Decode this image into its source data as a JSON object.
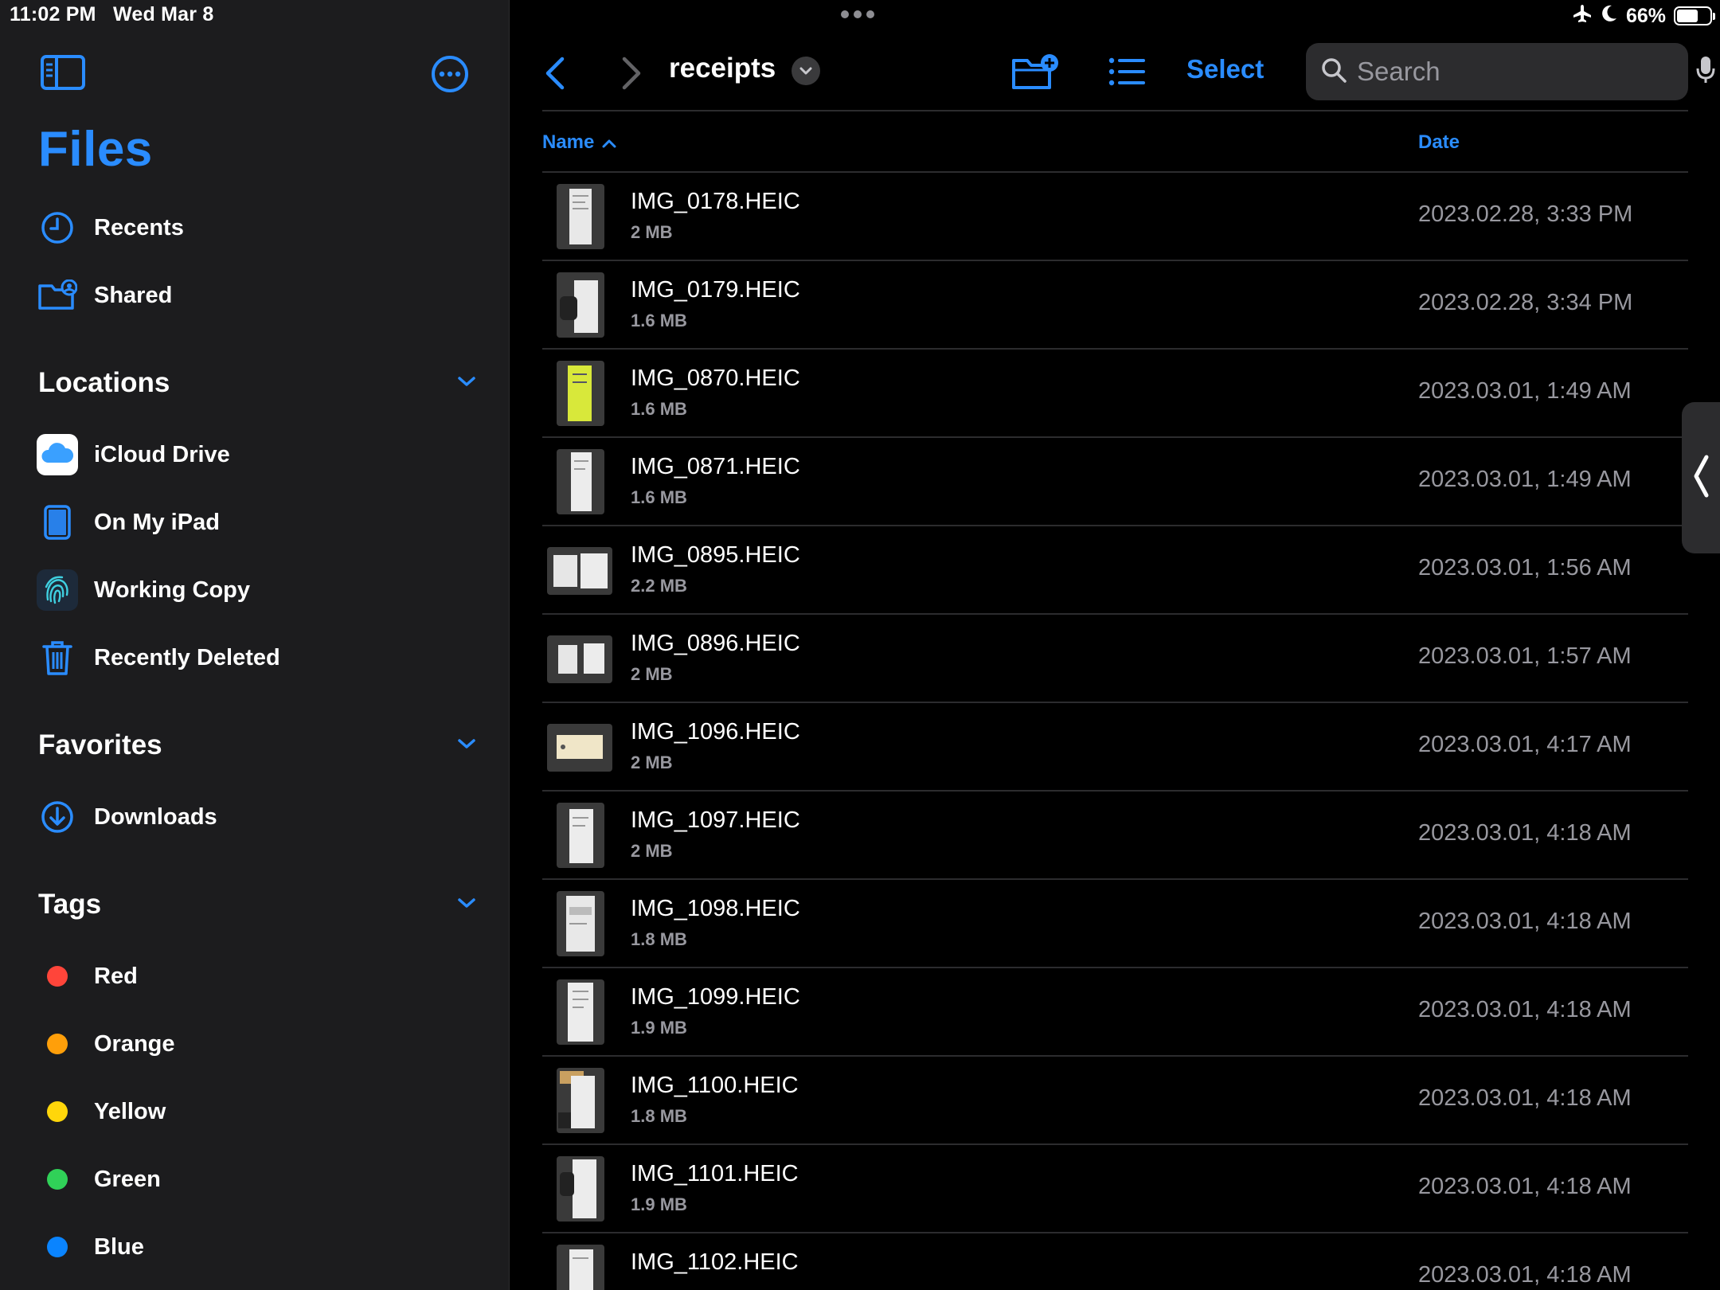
{
  "status_bar": {
    "time": "11:02 PM",
    "date": "Wed Mar 8",
    "battery": "66%",
    "battery_level": 0.66,
    "icons": [
      "airplane-icon",
      "moon-icon",
      "battery-icon"
    ]
  },
  "sidebar": {
    "title": "Files",
    "items": [
      {
        "label": "Recents",
        "icon": "clock-icon"
      },
      {
        "label": "Shared",
        "icon": "shared-folder-icon"
      }
    ],
    "locations": {
      "title": "Locations",
      "items": [
        {
          "label": "iCloud Drive",
          "icon": "icloud-icon"
        },
        {
          "label": "On My iPad",
          "icon": "ipad-icon"
        },
        {
          "label": "Working Copy",
          "icon": "fingerprint-icon"
        },
        {
          "label": "Recently Deleted",
          "icon": "trash-icon"
        }
      ]
    },
    "favorites": {
      "title": "Favorites",
      "items": [
        {
          "label": "Downloads",
          "icon": "download-icon"
        }
      ]
    },
    "tags": {
      "title": "Tags",
      "items": [
        {
          "label": "Red",
          "color": "#ff453a"
        },
        {
          "label": "Orange",
          "color": "#ff9f0a"
        },
        {
          "label": "Yellow",
          "color": "#ffd60a"
        },
        {
          "label": "Green",
          "color": "#30d158"
        },
        {
          "label": "Blue",
          "color": "#0a84ff"
        }
      ]
    }
  },
  "toolbar": {
    "folder_title": "receipts",
    "select_label": "Select",
    "search_placeholder": "Search"
  },
  "columns": {
    "name": "Name",
    "date": "Date"
  },
  "files": [
    {
      "name": "IMG_0178.HEIC",
      "size": "2 MB",
      "date": "2023.02.28, 3:33 PM"
    },
    {
      "name": "IMG_0179.HEIC",
      "size": "1.6 MB",
      "date": "2023.02.28, 3:34 PM"
    },
    {
      "name": "IMG_0870.HEIC",
      "size": "1.6 MB",
      "date": "2023.03.01, 1:49 AM"
    },
    {
      "name": "IMG_0871.HEIC",
      "size": "1.6 MB",
      "date": "2023.03.01, 1:49 AM"
    },
    {
      "name": "IMG_0895.HEIC",
      "size": "2.2 MB",
      "date": "2023.03.01, 1:56 AM"
    },
    {
      "name": "IMG_0896.HEIC",
      "size": "2 MB",
      "date": "2023.03.01, 1:57 AM"
    },
    {
      "name": "IMG_1096.HEIC",
      "size": "2 MB",
      "date": "2023.03.01, 4:17 AM"
    },
    {
      "name": "IMG_1097.HEIC",
      "size": "2 MB",
      "date": "2023.03.01, 4:18 AM"
    },
    {
      "name": "IMG_1098.HEIC",
      "size": "1.8 MB",
      "date": "2023.03.01, 4:18 AM"
    },
    {
      "name": "IMG_1099.HEIC",
      "size": "1.9 MB",
      "date": "2023.03.01, 4:18 AM"
    },
    {
      "name": "IMG_1100.HEIC",
      "size": "1.8 MB",
      "date": "2023.03.01, 4:18 AM"
    },
    {
      "name": "IMG_1101.HEIC",
      "size": "1.9 MB",
      "date": "2023.03.01, 4:18 AM"
    },
    {
      "name": "IMG_1102.HEIC",
      "size": "",
      "date": "2023.03.01, 4:18 AM"
    }
  ],
  "colors": {
    "accent": "#2a8cff",
    "sidebar_bg": "#1c1c1e",
    "main_bg": "#000000",
    "secondary_text": "#98989f"
  }
}
